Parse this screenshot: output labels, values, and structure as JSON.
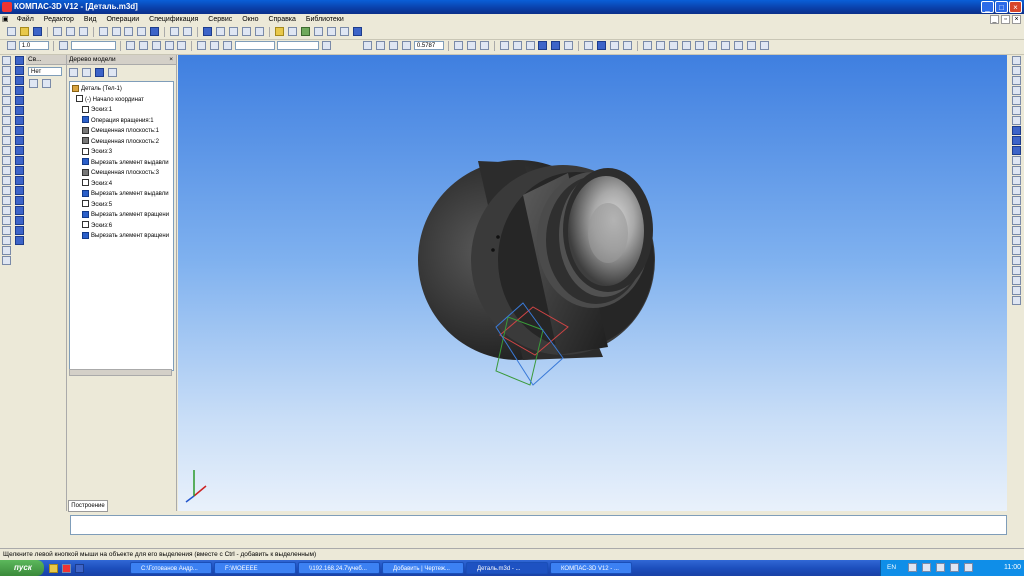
{
  "window": {
    "title": "КОМПАС-3D V12 - [Деталь.m3d]"
  },
  "menu": [
    "Файл",
    "Редактор",
    "Вид",
    "Операции",
    "Спецификация",
    "Сервис",
    "Окно",
    "Справка",
    "Библиотеки"
  ],
  "toolbar": {
    "line_width": "1.0",
    "zoom": "0.5787"
  },
  "panel_a": {
    "title": "Св...",
    "filter": "Нет"
  },
  "model_tree": {
    "title": "Дерево модели",
    "items": [
      {
        "label": "Деталь (Тел-1)",
        "kind": "root"
      },
      {
        "label": "(-) Начало координат",
        "kind": "origin"
      },
      {
        "label": "Эскиз:1",
        "kind": "sketch"
      },
      {
        "label": "Операция вращения:1",
        "kind": "op"
      },
      {
        "label": "Смещенная плоскость:1",
        "kind": "plane"
      },
      {
        "label": "Смещенная плоскость:2",
        "kind": "plane"
      },
      {
        "label": "Эскиз:3",
        "kind": "sketch"
      },
      {
        "label": "Вырезать элемент выдавли",
        "kind": "op"
      },
      {
        "label": "Смещенная плоскость:3",
        "kind": "plane"
      },
      {
        "label": "Эскиз:4",
        "kind": "sketch"
      },
      {
        "label": "Вырезать элемент выдавли",
        "kind": "op"
      },
      {
        "label": "Эскиз:5",
        "kind": "sketch"
      },
      {
        "label": "Вырезать элемент вращени",
        "kind": "op"
      },
      {
        "label": "Эскиз:6",
        "kind": "sketch"
      },
      {
        "label": "Вырезать элемент вращени",
        "kind": "op"
      }
    ]
  },
  "properties_tab": "Построение",
  "status_text": "Щелкните левой кнопкой мыши на объекте для его выделения (вместе с Ctrl - добавить к выделенным)",
  "taskbar": {
    "start": "пуск",
    "tasks": [
      "C:\\Готованов Андр...",
      "F:\\МОЕЕЕЕ",
      "\\\\192.168.24.7\\учеб...",
      "Добавить | Чертеж...",
      "Деталь.m3d - ...",
      "КОМПАС-3D V12 - ..."
    ],
    "language": "EN",
    "clock": "11:00"
  },
  "colors": {
    "accent": "#0a3fa8",
    "viewport_top": "#3f7fe0",
    "viewport_bottom": "#e9f1fb"
  }
}
